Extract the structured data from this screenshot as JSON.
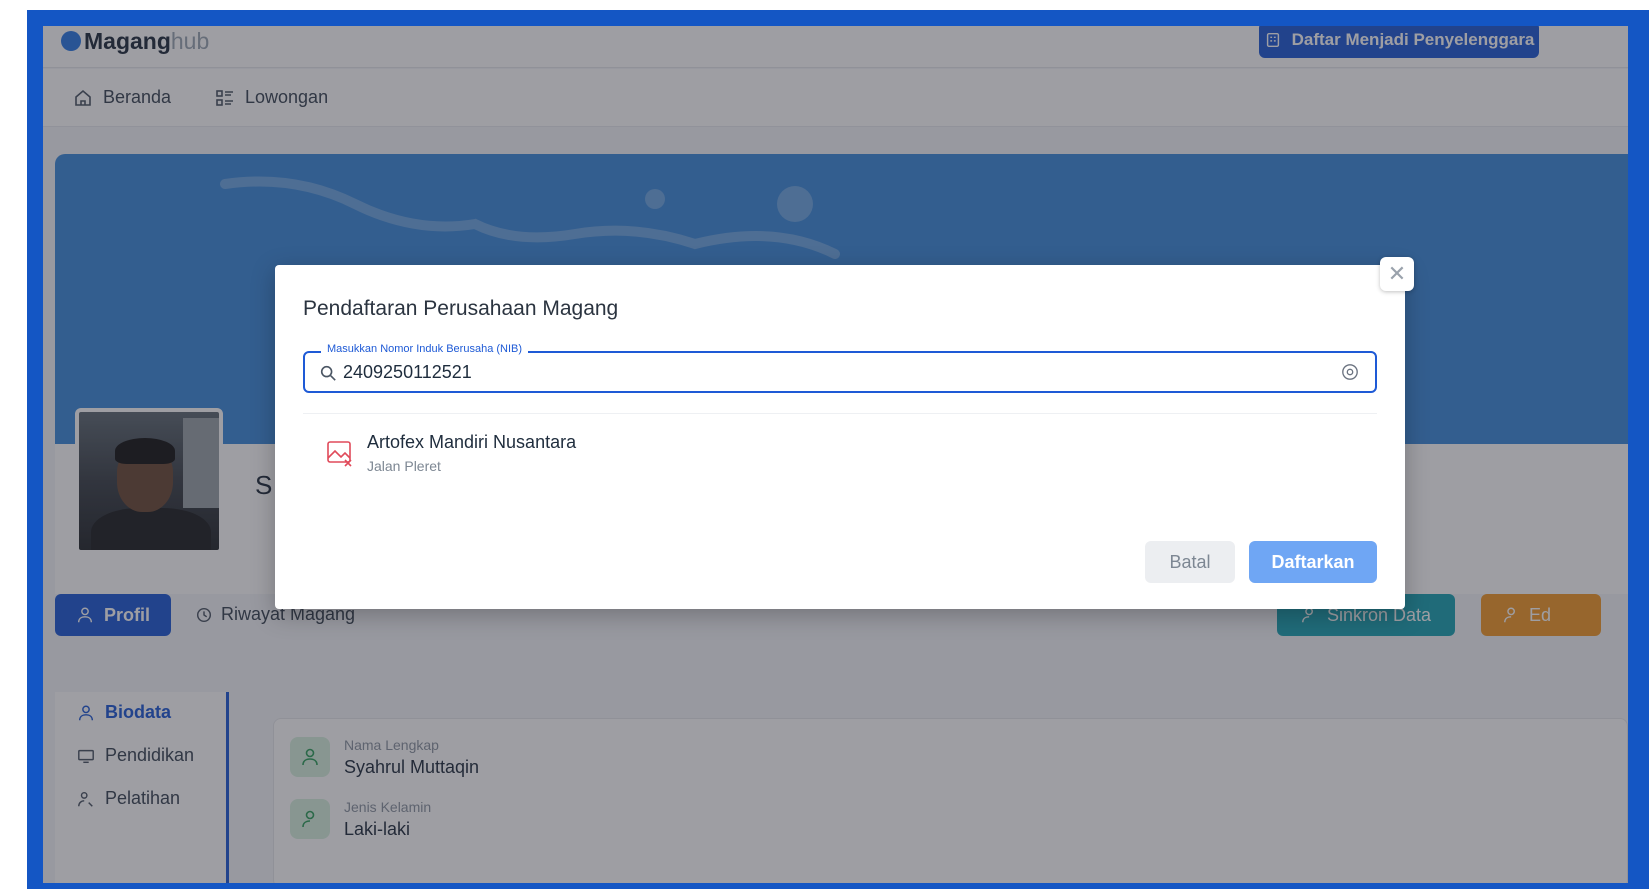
{
  "app": {
    "logo_main": "Magang",
    "logo_sub": "hub",
    "register_button": "Daftar Menjadi Penyelenggara"
  },
  "nav": {
    "items": [
      {
        "label": "Beranda",
        "icon": "home-icon"
      },
      {
        "label": "Lowongan",
        "icon": "list-icon"
      }
    ]
  },
  "profile": {
    "name_initial": "S",
    "tabs": {
      "profil": "Profil",
      "riwayat": "Riwayat Magang"
    },
    "sync_button": "Sinkron Data",
    "edit_button": "Ed",
    "sidebar": [
      {
        "label": "Biodata",
        "active": true
      },
      {
        "label": "Pendidikan",
        "active": false
      },
      {
        "label": "Pelatihan",
        "active": false
      }
    ],
    "fields": [
      {
        "label": "Nama Lengkap",
        "value": "Syahrul Muttaqin"
      },
      {
        "label": "Jenis Kelamin",
        "value": "Laki-laki"
      }
    ]
  },
  "modal": {
    "title": "Pendaftaran Perusahaan Magang",
    "nib_label": "Masukkan Nomor Induk Berusaha (NIB)",
    "nib_value": "2409250112521",
    "result": {
      "name": "Artofex Mandiri Nusantara",
      "address": "Jalan Pleret"
    },
    "cancel_button": "Batal",
    "submit_button": "Daftarkan",
    "close_symbol": "✕"
  },
  "colors": {
    "primary": "#1e5ad6",
    "frame": "#1456c4",
    "sync": "#1ba3b2",
    "edit": "#f29a28",
    "submit_disabled": "#6fa6f4"
  }
}
